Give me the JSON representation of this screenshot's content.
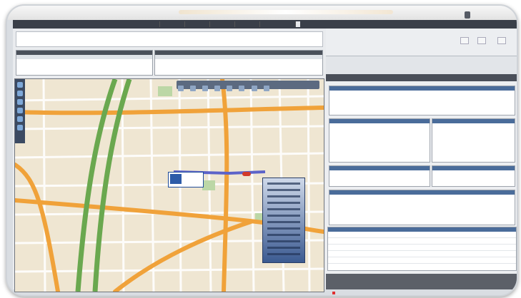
{
  "window": {
    "top_right_button": "",
    "left_tabs": [
      "",
      "",
      "",
      "",
      "",
      ""
    ]
  },
  "right_panel": {
    "tabs": [
      "",
      "",
      "",
      "",
      "",
      ""
    ],
    "buttons": [
      "",
      "",
      ""
    ]
  },
  "map": {
    "vehicle_marker": "vehicle",
    "info_panel_title": ""
  },
  "colors": {
    "dark_chrome": "#3a3f49",
    "map_bg": "#f1e8d4",
    "road_green": "#6aa84f",
    "road_orange": "#f0a23a",
    "route_purple": "#5c63c9",
    "panel_blue": "#3b5a91"
  }
}
